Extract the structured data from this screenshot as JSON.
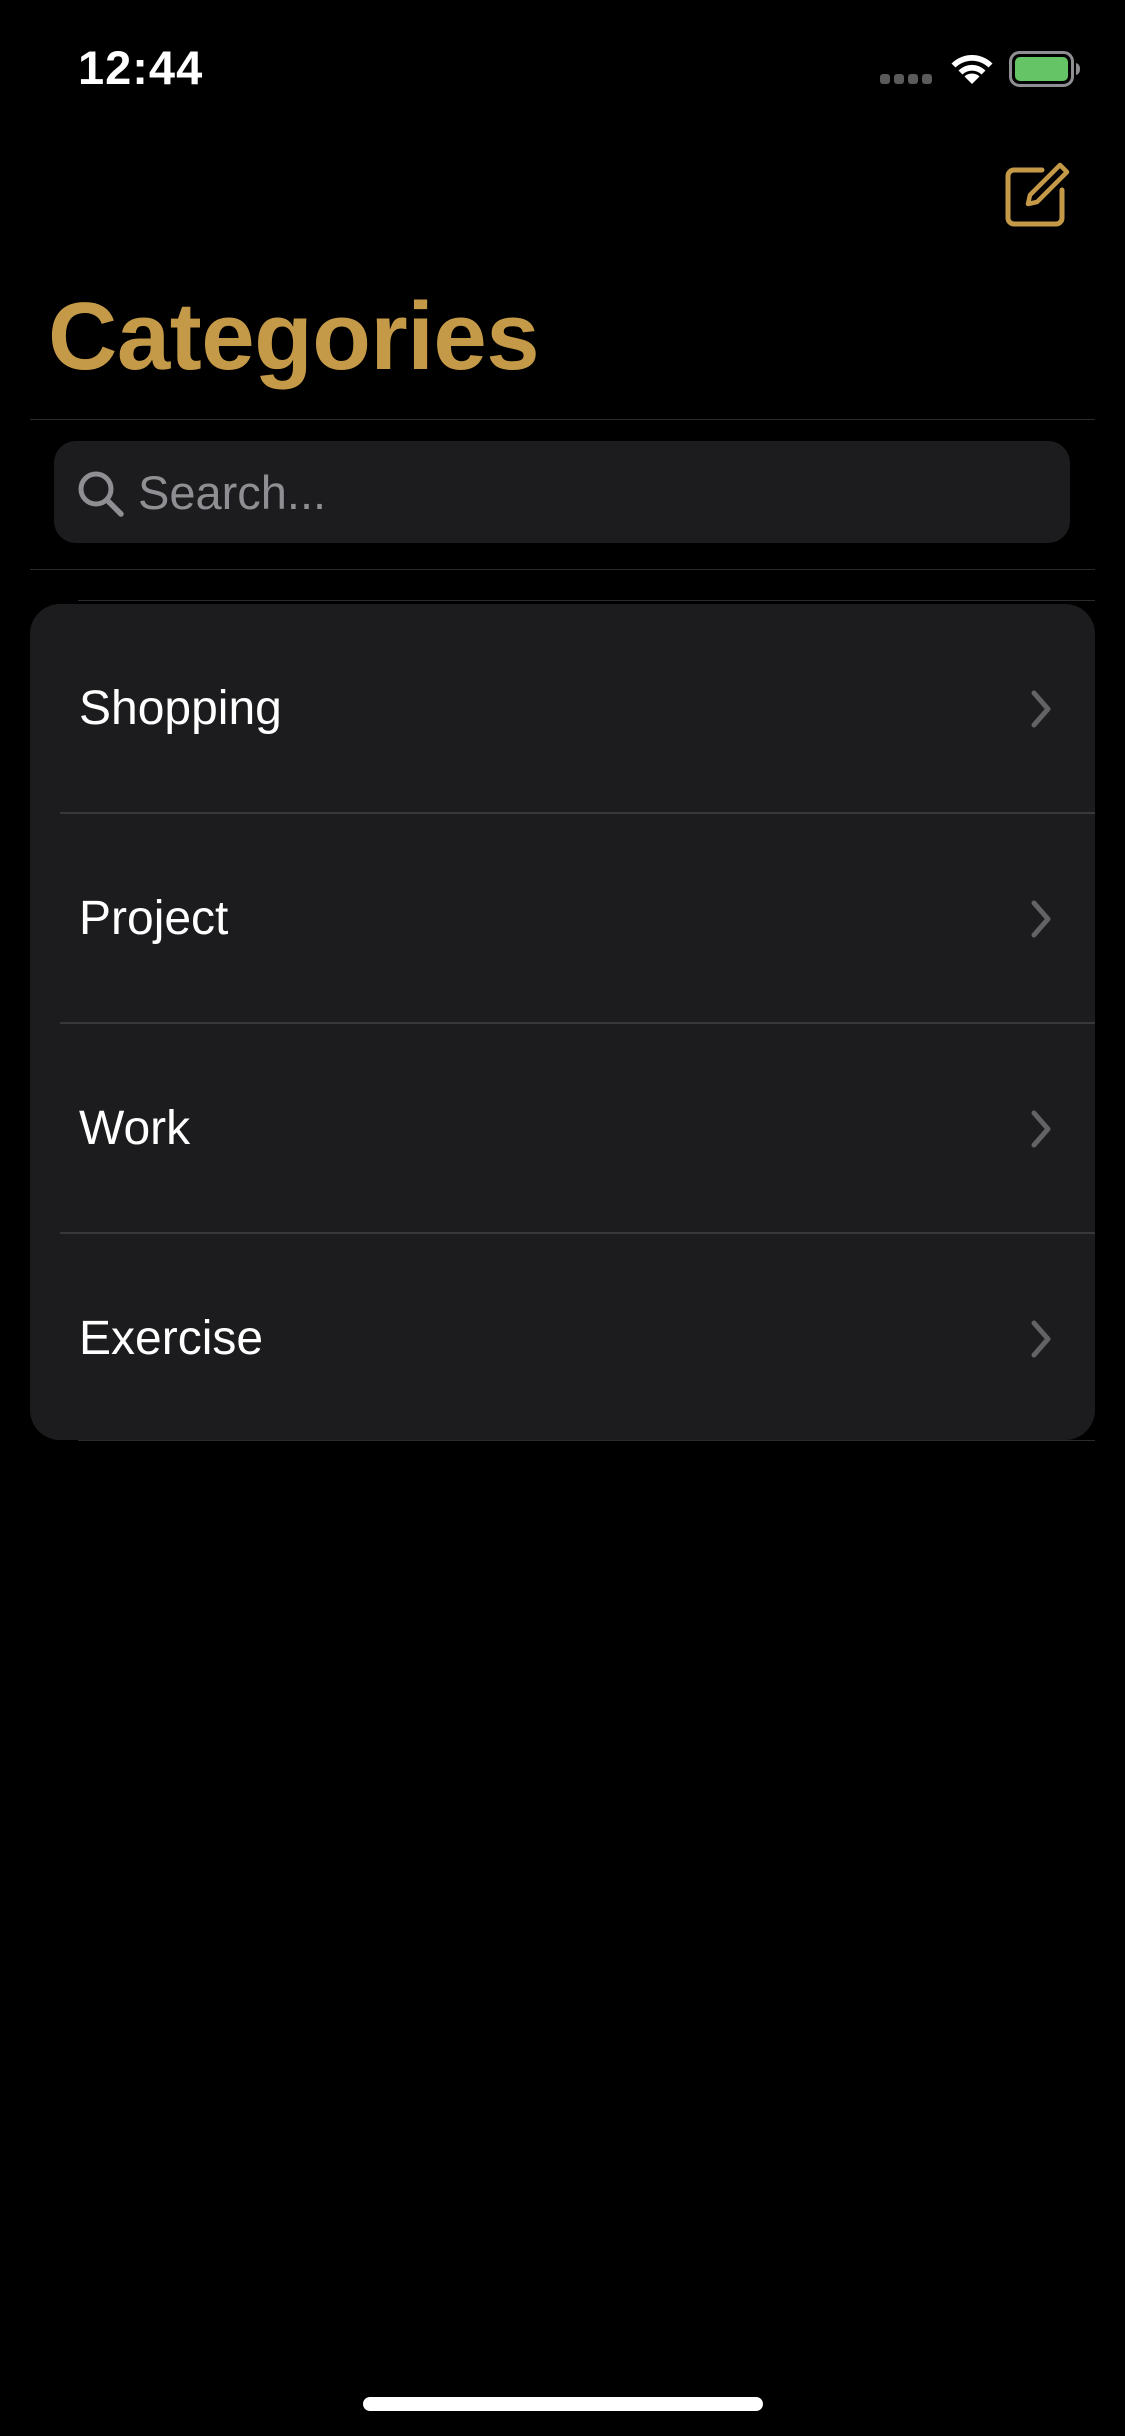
{
  "status_bar": {
    "time": "12:44",
    "battery_color": "#65c466"
  },
  "nav": {
    "title": "Categories",
    "compose_icon": "compose-icon",
    "accent_color": "#c49a48"
  },
  "search": {
    "value": "",
    "placeholder": "Search...",
    "icon": "search-icon"
  },
  "categories": [
    {
      "label": "Shopping",
      "icon": "chevron-right-icon"
    },
    {
      "label": "Project",
      "icon": "chevron-right-icon"
    },
    {
      "label": "Work",
      "icon": "chevron-right-icon"
    },
    {
      "label": "Exercise",
      "icon": "chevron-right-icon"
    }
  ]
}
